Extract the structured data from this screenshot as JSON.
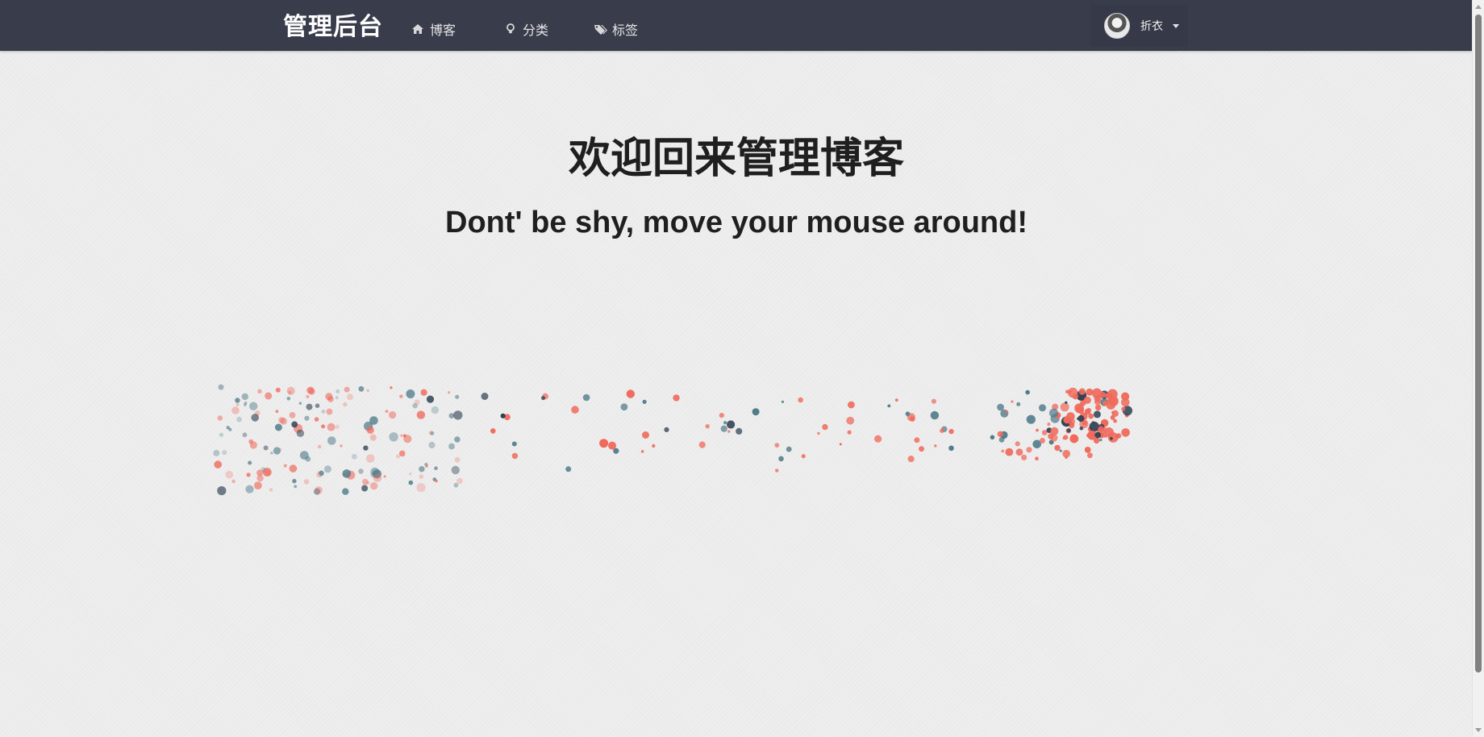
{
  "navbar": {
    "brand": "管理后台",
    "items": [
      {
        "label": "博客",
        "icon": "home-icon"
      },
      {
        "label": "分类",
        "icon": "lightbulb-icon"
      },
      {
        "label": "标签",
        "icon": "tags-icon"
      }
    ],
    "user": {
      "name": "折衣",
      "icon": "avatar",
      "dropdown_icon": "caret-down-icon"
    }
  },
  "hero": {
    "title": "欢迎回来管理博客",
    "subtitle": "Dont' be shy, move your mouse around!"
  },
  "colors": {
    "navbar_bg": "#393c4b",
    "particle_red": "#f06a5c",
    "particle_blue": "#4f7b8a",
    "particle_dark": "#2c3e50"
  }
}
